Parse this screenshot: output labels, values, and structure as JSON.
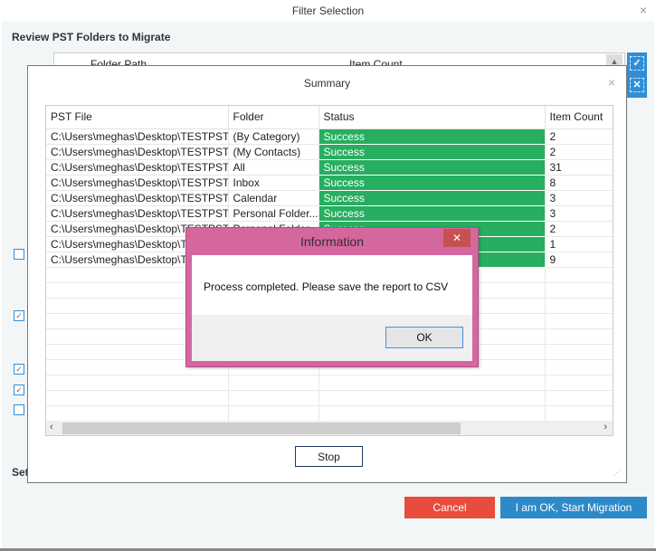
{
  "window": {
    "title": "Filter Selection",
    "close_icon": "×"
  },
  "review": {
    "heading": "Review PST Folders to Migrate",
    "columns": {
      "folder_path": "Folder Path",
      "item_count": "Item Count"
    },
    "scroll_up_icon": "▲",
    "select_all_icon": "✓",
    "deselect_all_icon": "✕"
  },
  "options": {
    "checkboxes": [
      {
        "checked": false,
        "mark": ""
      },
      {
        "checked": true,
        "mark": "✓"
      },
      {
        "checked": true,
        "mark": "✓"
      },
      {
        "checked": true,
        "mark": "✓"
      },
      {
        "checked": false,
        "mark": ""
      }
    ],
    "settings_label": "Set"
  },
  "footer": {
    "cancel_label": "Cancel",
    "start_label": "I am OK, Start Migration",
    "cancel_color": "#e74c3c",
    "start_color": "#2d8ac9"
  },
  "summary": {
    "title": "Summary",
    "close_icon": "×",
    "columns": [
      "PST File",
      "Folder",
      "Status",
      "Item Count"
    ],
    "rows": [
      {
        "pst_file": "C:\\Users\\meghas\\Desktop\\TESTPST ....",
        "folder": "(By Category)",
        "status": "Success",
        "item_count": "2"
      },
      {
        "pst_file": "C:\\Users\\meghas\\Desktop\\TESTPST ....",
        "folder": "(My Contacts)",
        "status": "Success",
        "item_count": "2"
      },
      {
        "pst_file": "C:\\Users\\meghas\\Desktop\\TESTPST ....",
        "folder": "All",
        "status": "Success",
        "item_count": "31"
      },
      {
        "pst_file": "C:\\Users\\meghas\\Desktop\\TESTPST ....",
        "folder": "Inbox",
        "status": "Success",
        "item_count": "8"
      },
      {
        "pst_file": "C:\\Users\\meghas\\Desktop\\TESTPST ....",
        "folder": "Calendar",
        "status": "Success",
        "item_count": "3"
      },
      {
        "pst_file": "C:\\Users\\meghas\\Desktop\\TESTPST ....",
        "folder": "Personal Folder...",
        "status": "Success",
        "item_count": "3"
      },
      {
        "pst_file": "C:\\Users\\meghas\\Desktop\\TESTPST ....",
        "folder": "Personal Folder...",
        "status": "Success",
        "item_count": "2"
      },
      {
        "pst_file": "C:\\Users\\meghas\\Desktop\\TESTPST ....",
        "folder": "",
        "status": "Success",
        "item_count": "1"
      },
      {
        "pst_file": "C:\\Users\\meghas\\Desktop\\TESTPST ....",
        "folder": "",
        "status": "Success",
        "item_count": "9"
      }
    ],
    "status_color": "#27ae60",
    "scroll_left_icon": "‹",
    "scroll_right_icon": "›",
    "stop_label": "Stop",
    "resize_icon": "⋰"
  },
  "information": {
    "title": "Information",
    "close_icon": "✕",
    "message": "Process completed. Please save the report to CSV",
    "ok_label": "OK",
    "frame_color": "#d5679f"
  }
}
